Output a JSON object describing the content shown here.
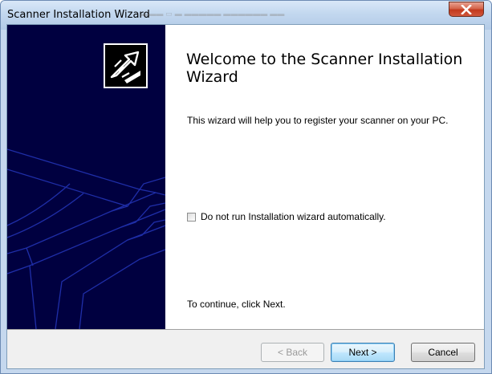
{
  "window": {
    "title": "Scanner Installation Wizard",
    "close_icon": "close-icon",
    "close_color": "#c2391d"
  },
  "sidebar": {
    "background": "#000040",
    "logo_icon": "wizard-arrow-icon",
    "artwork": "scanner-outline-graphic"
  },
  "content": {
    "heading": "Welcome to the Scanner Installation Wizard",
    "intro": "This wizard will help you to register your scanner on your PC.",
    "checkbox": {
      "label": "Do not run Installation wizard automatically.",
      "checked": false
    },
    "continue_text": "To continue, click Next."
  },
  "footer": {
    "back_label": "< Back",
    "back_enabled": false,
    "next_label": "Next >",
    "cancel_label": "Cancel"
  }
}
